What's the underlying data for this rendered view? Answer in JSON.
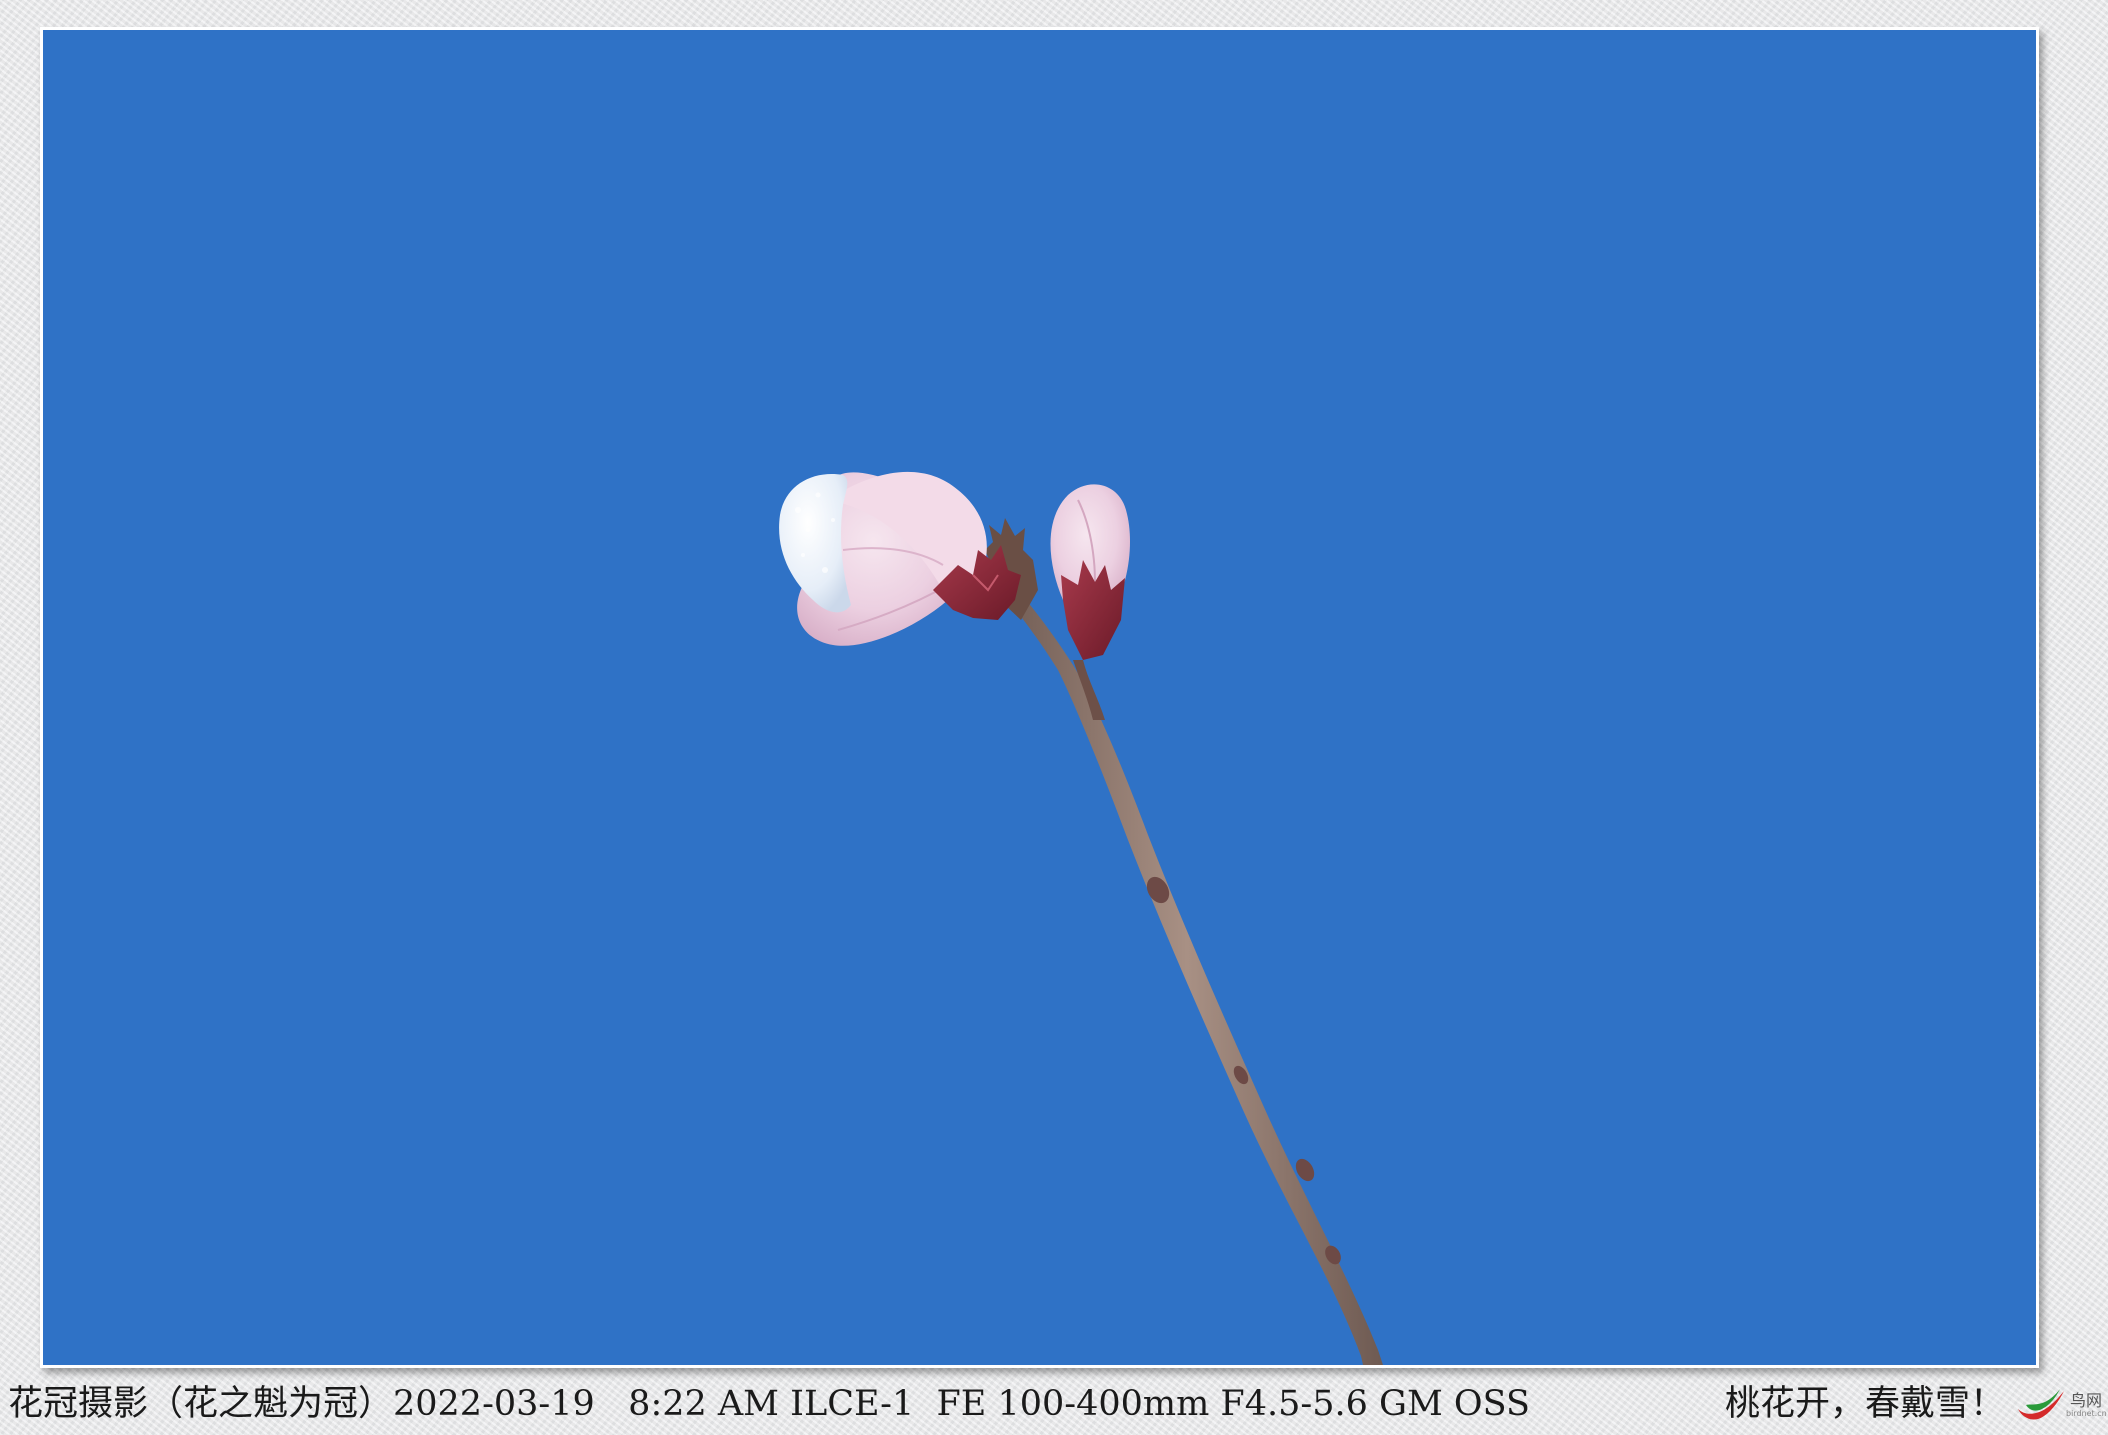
{
  "caption": "花冠摄影（花之魁为冠）2022-03-19   8:22 AM ILCE-1  FE 100-400mm F4.5-5.6 GM OSS",
  "title": "桃花开，春戴雪！",
  "watermark": {
    "name": "鸟网",
    "site": "birdnet.cn"
  },
  "colors": {
    "sky": "#2f72c6",
    "petal": "#efd6e6",
    "sepal": "#8a2236",
    "branch": "#8a7468",
    "snow": "#eef3fa"
  }
}
